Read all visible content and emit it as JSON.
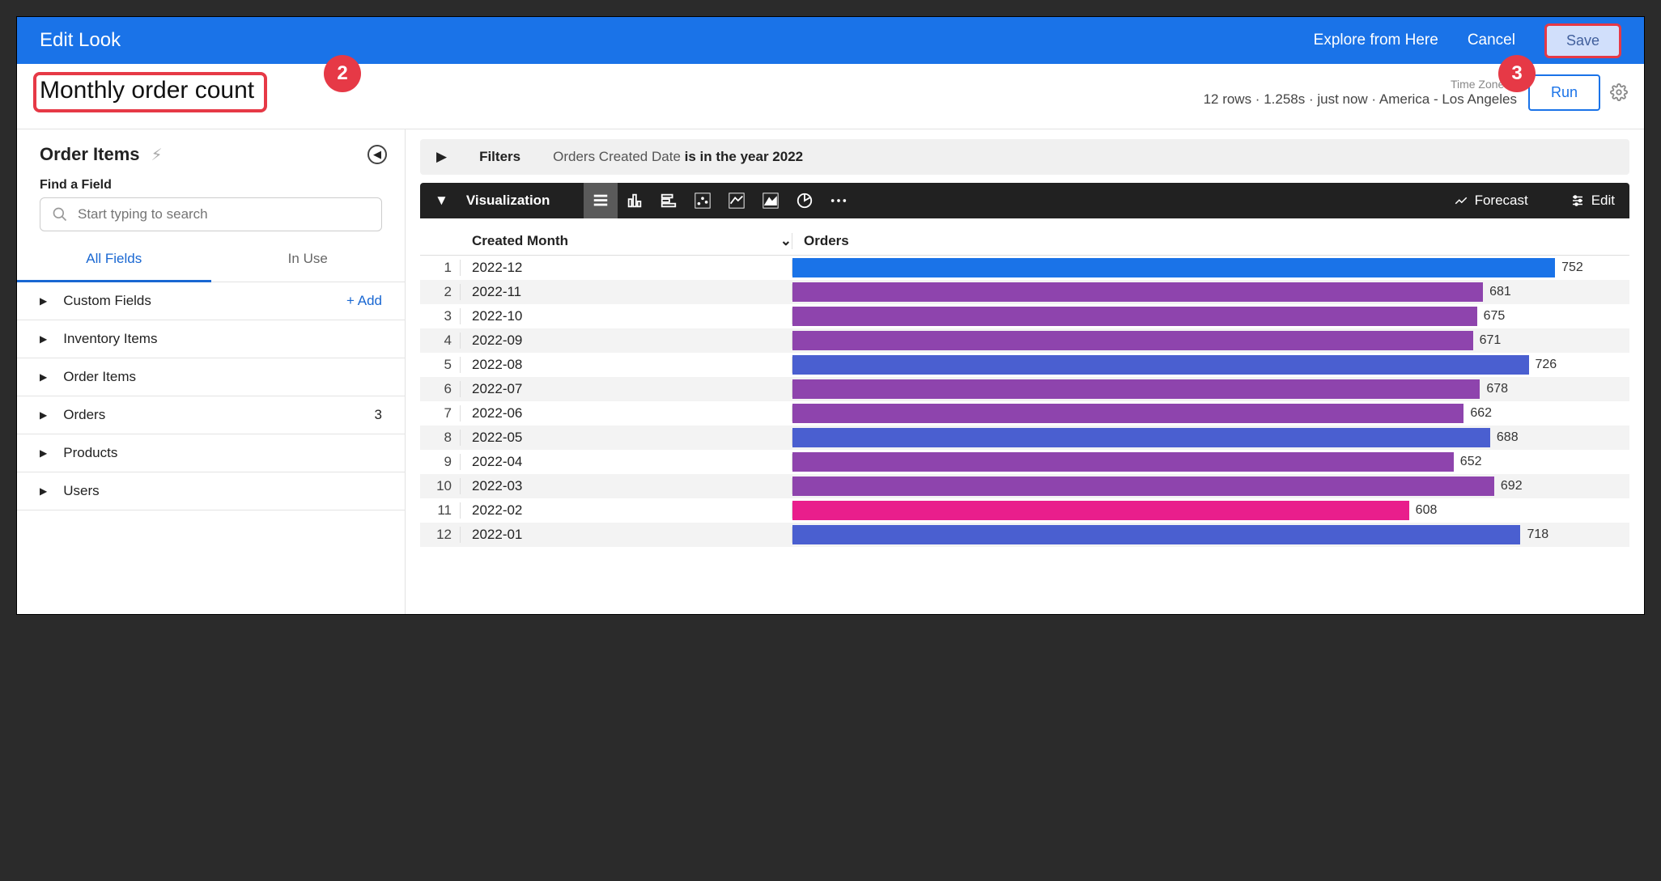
{
  "header": {
    "title": "Edit Look",
    "explore": "Explore from Here",
    "cancel": "Cancel",
    "save": "Save"
  },
  "annotations": {
    "badge2": "2",
    "badge3": "3"
  },
  "look": {
    "title": "Monthly order count",
    "status": "12 rows · 1.258s · just now · America - Los Angeles",
    "timezone_label": "Time Zone",
    "run": "Run"
  },
  "sidebar": {
    "explore_name": "Order Items",
    "find_label": "Find a Field",
    "search_placeholder": "Start typing to search",
    "tabs": {
      "all": "All Fields",
      "in_use": "In Use"
    },
    "custom_fields": {
      "label": "Custom Fields",
      "add": "+  Add"
    },
    "views": [
      {
        "label": "Inventory Items",
        "count": ""
      },
      {
        "label": "Order Items",
        "count": ""
      },
      {
        "label": "Orders",
        "count": "3"
      },
      {
        "label": "Products",
        "count": ""
      },
      {
        "label": "Users",
        "count": ""
      }
    ]
  },
  "filters": {
    "label": "Filters",
    "field": "Orders Created Date",
    "condition": "is in the year 2022"
  },
  "viz": {
    "label": "Visualization",
    "forecast": "Forecast",
    "edit": "Edit"
  },
  "table": {
    "col_month": "Created Month",
    "col_orders": "Orders"
  },
  "chart_data": {
    "type": "bar",
    "title": "Monthly order count",
    "xlabel": "Created Month",
    "ylabel": "Orders",
    "categories": [
      "2022-12",
      "2022-11",
      "2022-10",
      "2022-09",
      "2022-08",
      "2022-07",
      "2022-06",
      "2022-05",
      "2022-04",
      "2022-03",
      "2022-02",
      "2022-01"
    ],
    "values": [
      752,
      681,
      675,
      671,
      726,
      678,
      662,
      688,
      652,
      692,
      608,
      718
    ],
    "colors": [
      "#1a73e8",
      "#8e44ad",
      "#8e44ad",
      "#8e44ad",
      "#4a5fd0",
      "#8e44ad",
      "#8e44ad",
      "#4a5fd0",
      "#8e44ad",
      "#8e44ad",
      "#e91e8c",
      "#4a5fd0"
    ],
    "max": 752
  }
}
